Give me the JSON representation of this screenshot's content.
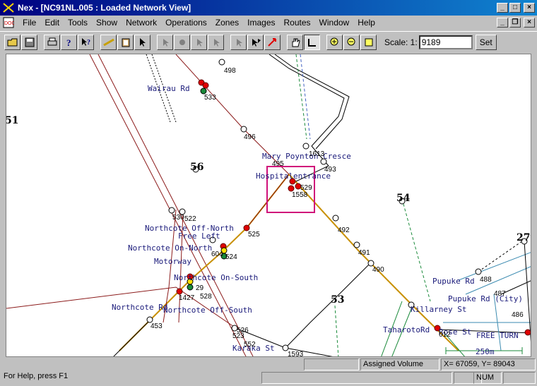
{
  "window": {
    "title": "Nex - [NC91NL.005 : Loaded Network View]",
    "min_label": "_",
    "max_label": "□",
    "close_label": "×",
    "child_min_label": "_",
    "child_restore_label": "❐",
    "child_close_label": "×"
  },
  "menu": [
    "File",
    "Edit",
    "Tools",
    "Show",
    "Network",
    "Operations",
    "Zones",
    "Images",
    "Routes",
    "Window",
    "Help"
  ],
  "toolbar": {
    "buttons": [
      "open-folder-icon",
      "save-disk-icon",
      "print-icon",
      "help-icon",
      "context-help-icon",
      "measure-ruler-icon",
      "clipboard-icon",
      "select-arrow-icon",
      "add-node-icon",
      "move-node-icon",
      "node-arrow-icon",
      "link-arrow-icon",
      "link-select-icon",
      "flag-arrow-icon",
      "red-arrow-icon",
      "hand-pan-icon",
      "corner-select-icon",
      "zoom-in-icon",
      "zoom-out-icon",
      "zoom-extent-icon"
    ],
    "scale_label": "Scale:  1:",
    "scale_value": "9189",
    "set_label": "Set"
  },
  "map": {
    "street_labels": [
      "Wairau Rd",
      "Mary Poynton Cresce",
      "Hospitalentrance",
      "Northcote Off-North",
      "Free Left",
      "Northcote On-North",
      "Motorway",
      "Northcote On-South",
      "Northcote Rd",
      "Northcote Off-South",
      "Karaka St",
      "Pupuke Rd",
      "Pupuke Rd (City)",
      "Killarney St",
      "TaharotoRd",
      "Rose St",
      "FREE TURN"
    ],
    "node_labels": [
      "498",
      "533",
      "496",
      "1613",
      "493",
      "495",
      "529",
      "1558",
      "492",
      "491",
      "490",
      "525",
      "522",
      "530",
      "604",
      "524",
      "1427",
      "528",
      "29",
      "453",
      "526",
      "523",
      "552",
      "1593",
      "488",
      "487",
      "486",
      "612"
    ],
    "zone_labels": [
      "51",
      "56",
      "54",
      "27",
      "53"
    ],
    "scale_bar_label": "250m",
    "colors": {
      "road_primary": "#8b1a1a",
      "road_secondary": "#000000",
      "transit": "#1a8a3a",
      "selected_link": "#e0a800",
      "node_red": "#e00000",
      "highlight_box": "#d0107a"
    }
  },
  "status": {
    "help": "For Help, press F1",
    "mode": "Assigned Volume",
    "coords": "X=  67059, Y=  89043",
    "num": "NUM"
  }
}
